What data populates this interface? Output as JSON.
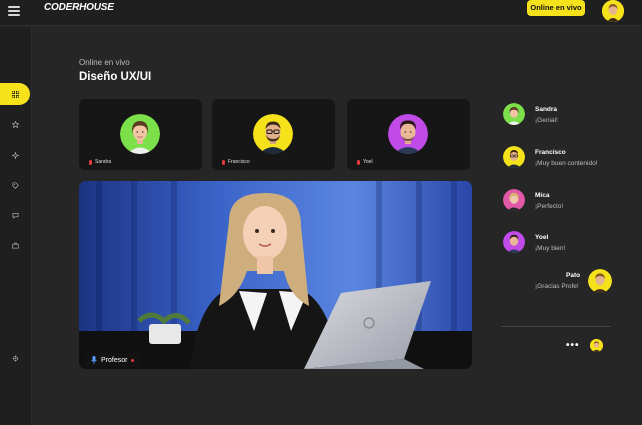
{
  "header": {
    "logo": "CODERHOUSE",
    "live_button": "Online en vivo"
  },
  "sidebar": {
    "items": [
      {
        "icon": "grid-icon",
        "active": true
      },
      {
        "icon": "star-icon",
        "active": false
      },
      {
        "icon": "sparkle-icon",
        "active": false
      },
      {
        "icon": "tag-icon",
        "active": false
      },
      {
        "icon": "chat-icon",
        "active": false
      },
      {
        "icon": "briefcase-icon",
        "active": false
      },
      {
        "icon": "settings-icon",
        "active": false
      }
    ]
  },
  "page": {
    "subtitle": "Online en vivo",
    "title": "Diseño UX/UI"
  },
  "participants": [
    {
      "name": "Sandra",
      "ring_color": "#7be04a"
    },
    {
      "name": "Francisco",
      "ring_color": "#f5e21a"
    },
    {
      "name": "Yoel",
      "ring_color": "#c14be8"
    }
  ],
  "main_video": {
    "speaker_label": "Profesor"
  },
  "chat": {
    "messages": [
      {
        "name": "Sandra",
        "text": "¡Genial!",
        "ring_color": "#7be04a"
      },
      {
        "name": "Francisco",
        "text": "¡Muy buen contenido!",
        "ring_color": "#f5e21a"
      },
      {
        "name": "Mica",
        "text": "¡Perfecto!",
        "ring_color": "#e058a8"
      },
      {
        "name": "Yoel",
        "text": "¡Muy bien!",
        "ring_color": "#c14be8"
      },
      {
        "name": "Pato",
        "text": "¡Gracias Profe!",
        "ring_color": "#f5e21a"
      }
    ],
    "more_label": "•••"
  },
  "colors": {
    "accent": "#f5e21a",
    "background": "#262626",
    "panel": "#1f1f1f",
    "live_dot": "#e23b3b"
  }
}
